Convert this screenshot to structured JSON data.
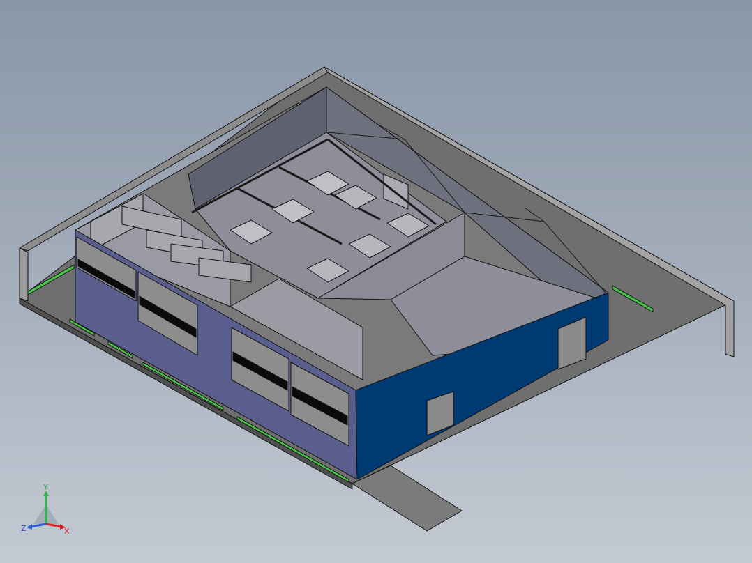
{
  "viewport": {
    "background_top": "#8a96a7",
    "background_bottom": "#c4cad3"
  },
  "model": {
    "colors": {
      "slab_gray": "#6f6f6f",
      "wall_gray": "#8e8e8e",
      "wall_dark": "#5e5e5e",
      "floor_inner": "#8d8e9a",
      "facade_blue": "#003a73",
      "facade_purple": "#5a5e8c",
      "window_green": "#49c24a",
      "window_black": "#0b0b0b",
      "edge_black": "#111111"
    }
  },
  "triad": {
    "y_label": "Y",
    "x_label": "X",
    "z_label": "Z",
    "y_color": "#2fb54a",
    "x_color": "#d8232a",
    "z_color": "#2f5fd0"
  }
}
